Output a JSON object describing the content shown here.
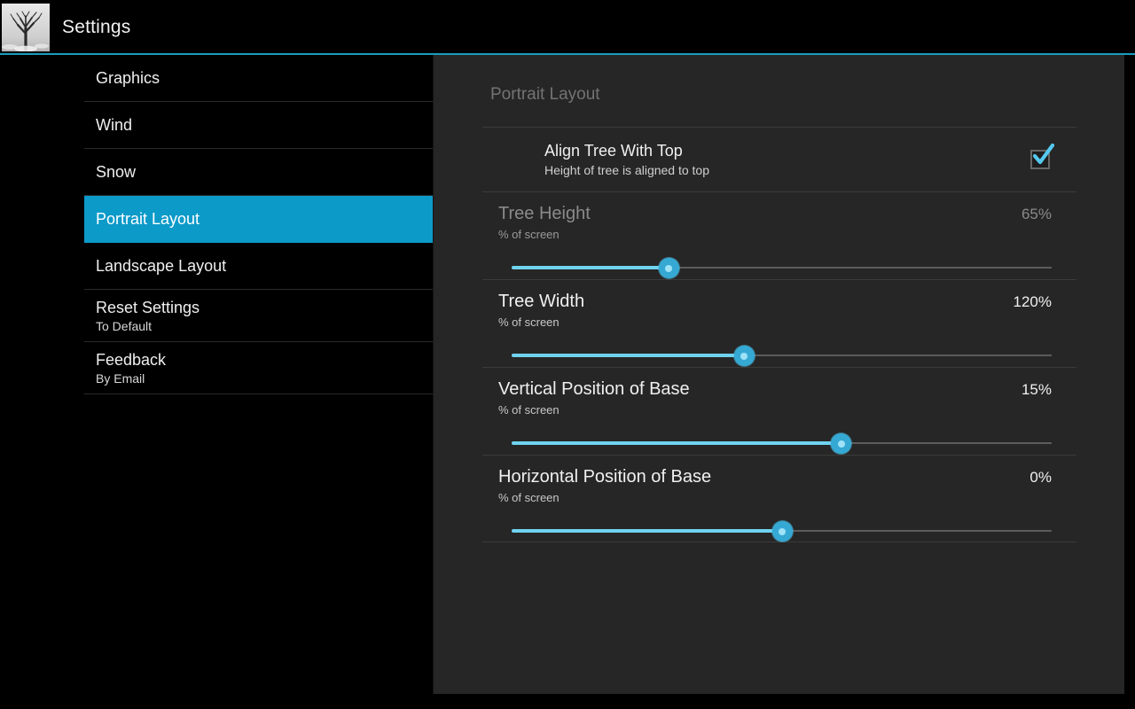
{
  "header": {
    "app_title": "Settings",
    "icon_name": "snowy-tree-app-icon",
    "accent_rule_color": "#1a9cc0"
  },
  "sidebar": {
    "items": [
      {
        "label": "Graphics",
        "sub": "",
        "selected": false
      },
      {
        "label": "Wind",
        "sub": "",
        "selected": false
      },
      {
        "label": "Snow",
        "sub": "",
        "selected": false
      },
      {
        "label": "Portrait Layout",
        "sub": "",
        "selected": true
      },
      {
        "label": "Landscape Layout",
        "sub": "",
        "selected": false
      },
      {
        "label": "Reset Settings",
        "sub": "To Default",
        "selected": false
      },
      {
        "label": "Feedback",
        "sub": "By Email",
        "selected": false
      }
    ],
    "selected_bg": "#0c9ac9"
  },
  "panel": {
    "title": "Portrait Layout",
    "checkbox_row": {
      "title": "Align Tree With Top",
      "subtitle": "Height of tree is aligned to top",
      "checked": true,
      "check_color": "#55c8ef"
    },
    "sliders": [
      {
        "title": "Tree Height",
        "subtitle": "% of screen",
        "value": "65%",
        "fill_percent": 29,
        "disabled": true
      },
      {
        "title": "Tree Width",
        "subtitle": "% of screen",
        "value": "120%",
        "fill_percent": 43,
        "disabled": false
      },
      {
        "title": "Vertical Position of Base",
        "subtitle": "% of screen",
        "value": "15%",
        "fill_percent": 61,
        "disabled": false
      },
      {
        "title": "Horizontal Position of Base",
        "subtitle": "% of screen",
        "value": "0%",
        "fill_percent": 50,
        "disabled": false
      }
    ]
  }
}
